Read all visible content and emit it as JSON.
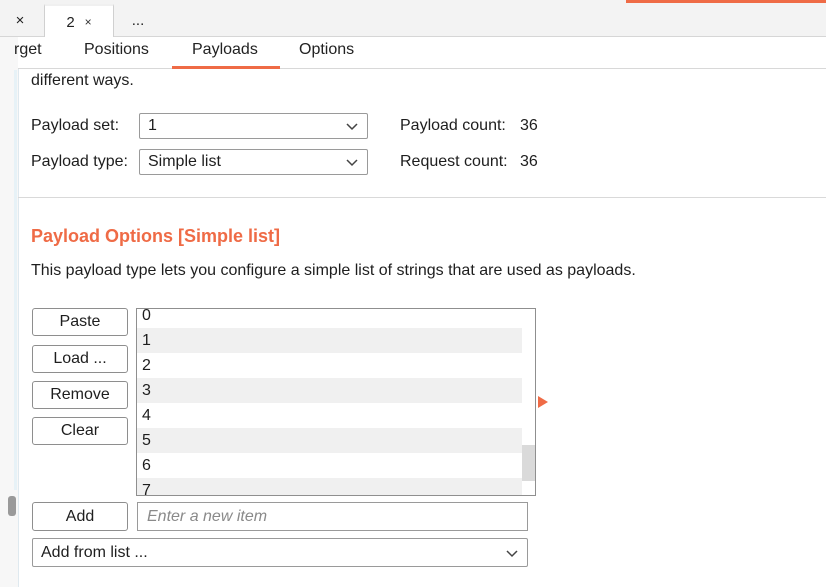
{
  "tabs": [
    {
      "label": "×"
    },
    {
      "label": "2",
      "close": "×"
    },
    {
      "label": "..."
    }
  ],
  "subtabs": [
    "rget",
    "Positions",
    "Payloads",
    "Options"
  ],
  "intro_text": "different ways.",
  "payload_set": {
    "label": "Payload set:",
    "value": "1"
  },
  "payload_type": {
    "label": "Payload type:",
    "value": "Simple list"
  },
  "payload_count": {
    "label": "Payload count:",
    "value": "36"
  },
  "request_count": {
    "label": "Request count:",
    "value": "36"
  },
  "section": {
    "title": "Payload Options [Simple list]",
    "description": "This payload type lets you configure a simple list of strings that are used as payloads."
  },
  "buttons": {
    "paste": "Paste",
    "load": "Load ...",
    "remove": "Remove",
    "clear": "Clear",
    "add": "Add"
  },
  "list_items": [
    "0",
    "1",
    "2",
    "3",
    "4",
    "5",
    "6",
    "7"
  ],
  "new_item": {
    "placeholder": "Enter a new item",
    "value": ""
  },
  "add_from_list": {
    "value": "Add from list ..."
  },
  "colors": {
    "accent": "#ef6b46"
  },
  "icons": {
    "chevron": "chevron-down-icon",
    "arrow": "expand-arrow-icon"
  }
}
